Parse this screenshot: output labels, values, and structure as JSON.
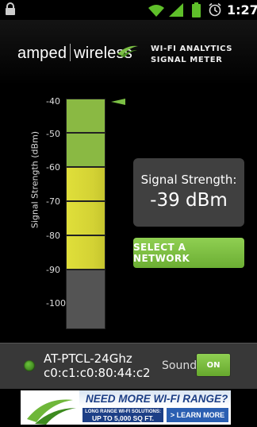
{
  "status_bar": {
    "time": "1:27",
    "icons": [
      "lock-icon",
      "wifi-icon",
      "cell-signal-icon",
      "battery-icon",
      "alarm-icon"
    ]
  },
  "header": {
    "logo_left": "amped",
    "logo_right": "wireless",
    "subtitle_line1": "WI-FI ANALYTICS",
    "subtitle_line2": "SIGNAL METER"
  },
  "meter": {
    "axis_label": "Signal Strength (dBm)",
    "ticks": [
      "-40",
      "-50",
      "-60",
      "-70",
      "-80",
      "-90",
      "-100"
    ],
    "zone_colors": {
      "strong": "#8ab943",
      "medium": "#e0df3a",
      "weak": "#545454"
    }
  },
  "signal": {
    "label": "Signal Strength:",
    "value": "-39 dBm"
  },
  "buttons": {
    "select_network": "SELECT A NETWORK"
  },
  "network": {
    "ssid": "AT-PTCL-24Ghz",
    "mac": "c0:c1:c0:80:44:c2",
    "sound_label": "Sound",
    "sound_toggle": "ON"
  },
  "ad": {
    "headline": "NEED MORE WI-FI RANGE?",
    "sub_line1": "LONG RANGE WI-FI SOLUTIONS:",
    "sub_line2": "UP TO 5,000 SQ FT.",
    "cta": "LEARN MORE"
  },
  "colors": {
    "accent_green": "#7bbf44",
    "panel_gray": "#404040",
    "ad_blue": "#1d3f86"
  }
}
